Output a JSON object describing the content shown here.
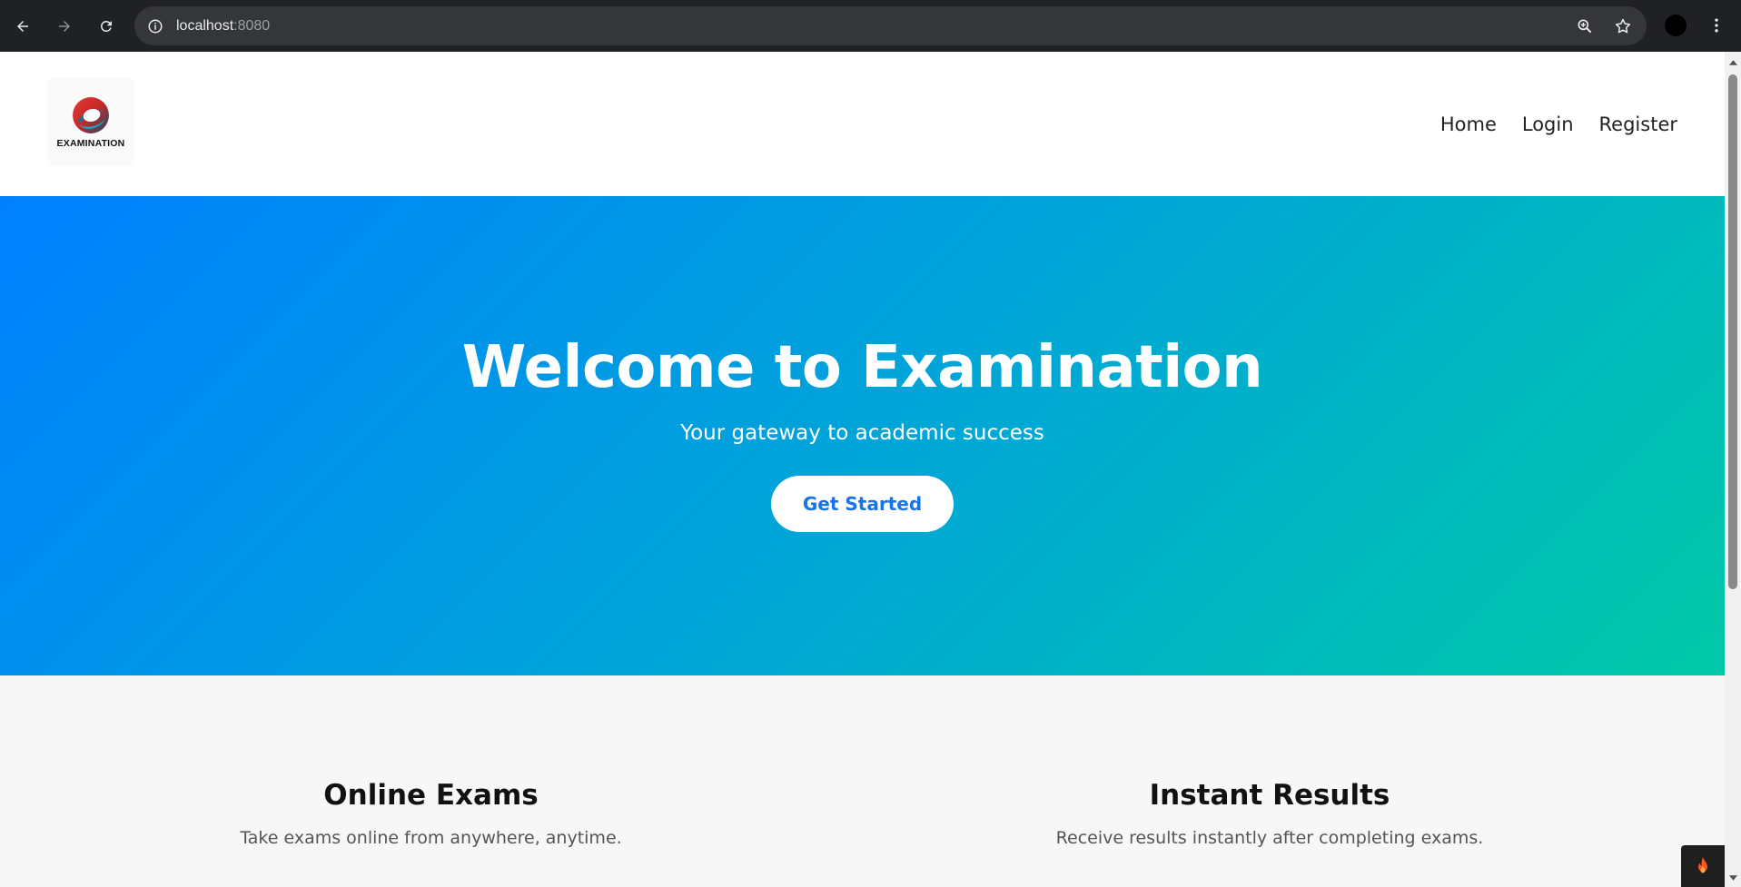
{
  "browser": {
    "url_host": "localhost",
    "url_port": ":8080",
    "icons": [
      "back-arrow-icon",
      "forward-arrow-icon",
      "reload-icon",
      "site-info-icon",
      "zoom-icon",
      "bookmark-star-icon",
      "profile-avatar",
      "menu-dots-icon"
    ]
  },
  "header": {
    "logo_text": "EXAMINATION",
    "nav": [
      {
        "label": "Home"
      },
      {
        "label": "Login"
      },
      {
        "label": "Register"
      }
    ]
  },
  "hero": {
    "title": "Welcome to Examination",
    "subtitle": "Your gateway to academic success",
    "cta_label": "Get Started",
    "gradient_start": "#0080ff",
    "gradient_end": "#00c9a7",
    "cta_text_color": "#1a73e8"
  },
  "features": [
    {
      "title": "Online Exams",
      "description": "Take exams online from anywhere, anytime."
    },
    {
      "title": "Instant Results",
      "description": "Receive results instantly after completing exams."
    }
  ],
  "widget": {
    "icon": "flame-icon"
  }
}
